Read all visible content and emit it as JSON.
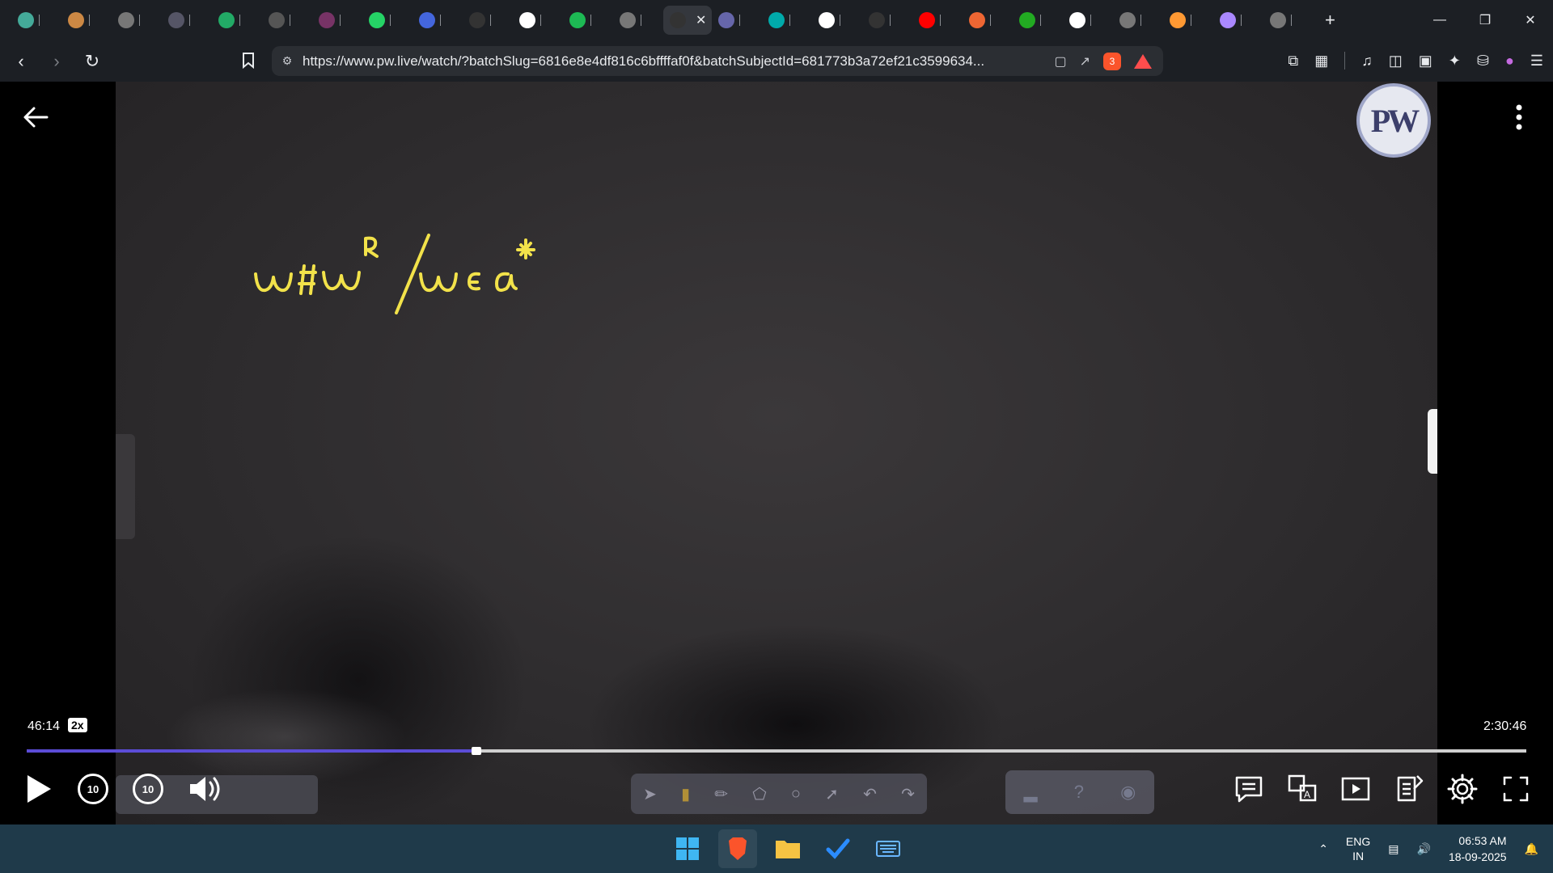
{
  "browser": {
    "tabs": [
      {
        "icon": "chat-icon",
        "color": "#4a9"
      },
      {
        "icon": "pw-icon",
        "color": "#c84"
      },
      {
        "icon": "globe-icon",
        "color": "#777"
      },
      {
        "icon": "scrapper-icon",
        "color": "#556"
      },
      {
        "icon": "wordpress-icon",
        "color": "#2a6"
      },
      {
        "icon": "db-icon",
        "color": "#555"
      },
      {
        "icon": "alien-icon",
        "color": "#736"
      },
      {
        "icon": "whatsapp-icon",
        "color": "#25d366"
      },
      {
        "icon": "pen-icon",
        "color": "#4466dd"
      },
      {
        "icon": "orip-icon",
        "color": "#333"
      },
      {
        "icon": "google-icon",
        "color": "#fff"
      },
      {
        "icon": "spotify-icon",
        "color": "#1db954"
      },
      {
        "icon": "globe-icon",
        "color": "#777"
      },
      {
        "icon": "pw-active-icon",
        "color": "#333",
        "active": true
      },
      {
        "icon": "gemini-icon",
        "color": "#66a"
      },
      {
        "icon": "chatgpt-icon",
        "color": "#0aa"
      },
      {
        "icon": "google-icon",
        "color": "#fff"
      },
      {
        "icon": "screen-icon",
        "color": "#333"
      },
      {
        "icon": "youtube-icon",
        "color": "#f00"
      },
      {
        "icon": "disc-icon",
        "color": "#e63"
      },
      {
        "icon": "leetcode-icon",
        "color": "#2a2"
      },
      {
        "icon": "wikipedia-icon",
        "color": "#fff"
      },
      {
        "icon": "globe-icon",
        "color": "#777"
      },
      {
        "icon": "india-flag-icon",
        "color": "#f93"
      },
      {
        "icon": "circle-icon",
        "color": "#a8f"
      },
      {
        "icon": "globe-icon",
        "color": "#777"
      }
    ],
    "url": "https://www.pw.live/watch/?batchSlug=6816e8e4df816c6bffffaf0f&batchSubjectId=681773b3a72ef21c3599634...",
    "brave_badge": "3"
  },
  "player": {
    "current_time": "46:14",
    "speed": "2x",
    "total_time": "2:30:46",
    "progress": 0.3,
    "skip_back": "10",
    "skip_forward": "10",
    "logo_text": "PW"
  },
  "taskbar": {
    "lang_top": "ENG",
    "lang_bottom": "IN",
    "time": "06:53 AM",
    "date": "18-09-2025"
  }
}
